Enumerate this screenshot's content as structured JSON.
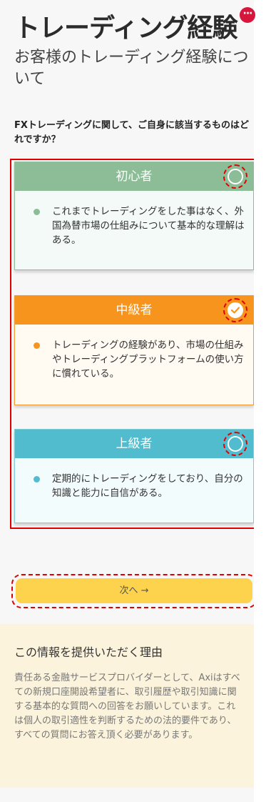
{
  "header": {
    "title": "トレーディング経験",
    "subtitle": "お客様のトレーディング経験について",
    "notification_badge": "···"
  },
  "question": "FXトレーディングに関して、ご自身に該当するものはどれですか？",
  "options": [
    {
      "label": "初心者",
      "description": "これまでトレーディングをした事はなく、外国為替市場の仕組みについて基本的な理解はある。",
      "selected": false,
      "color": "#8dbd97"
    },
    {
      "label": "中級者",
      "description": "トレーディングの経験があり、市場の仕組みやトレーディングプラットフォームの使い方に慣れている。",
      "selected": true,
      "color": "#f7941d"
    },
    {
      "label": "上級者",
      "description": "定期的にトレーディングをしており、自分の知識と能力に自信がある。",
      "selected": false,
      "color": "#50bccd"
    }
  ],
  "next_button": {
    "label": "次へ →",
    "color": "#fdd24d"
  },
  "info": {
    "title": "この情報を提供いただく理由",
    "text": "責任ある金融サービスプロバイダーとして、Axiはすべての新規口座開設希望者に、取引履歴や取引知識に関する基本的な質問への回答をお願いしています。これは個人の取引適性を判断するための法的要件であり、すべての質問にお答え頂く必要があります。"
  },
  "colors": {
    "annotation": "#e00000",
    "badge": "#d6163a",
    "info_background": "#fbf3dc"
  }
}
